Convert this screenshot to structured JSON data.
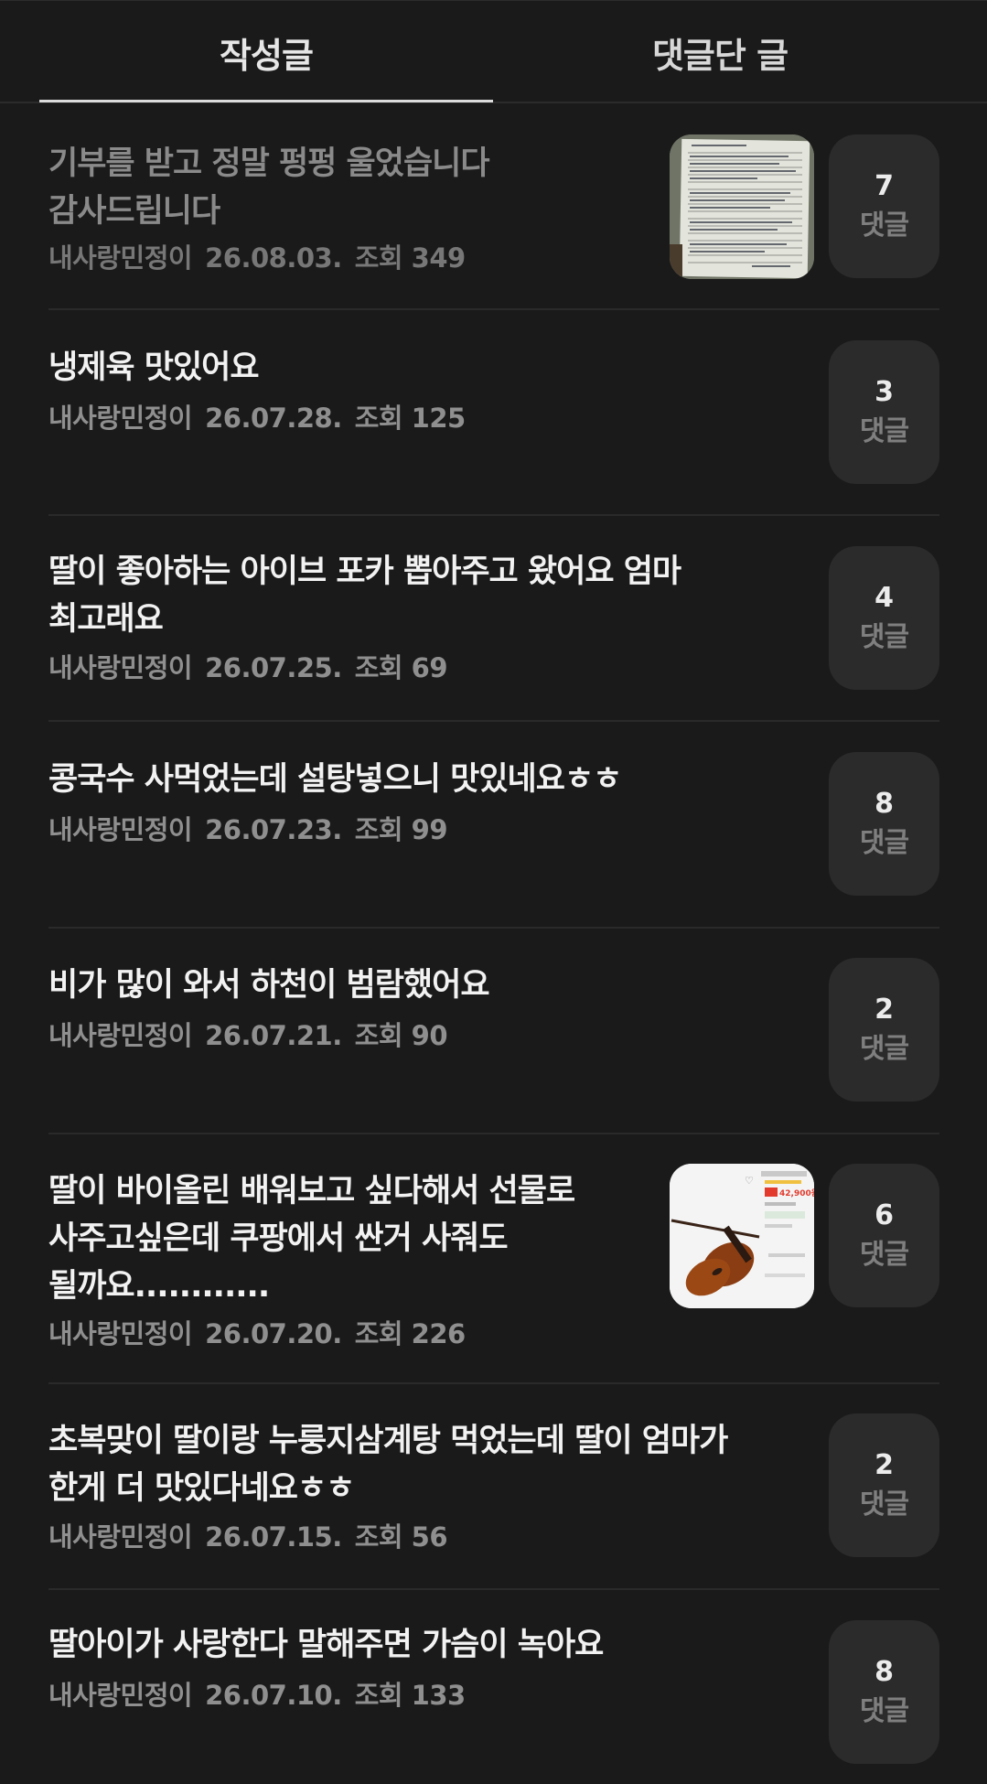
{
  "tabs": [
    {
      "label": "작성글"
    },
    {
      "label": "댓글단 글"
    }
  ],
  "comment_label": "댓글",
  "posts": [
    {
      "title": "기부를 받고 정말 펑펑 울었습니다\n감사드립니다",
      "author": "내사랑민정이",
      "date": "26.08.03.",
      "views": "조회 349",
      "comments": "7",
      "thumbnail": "letter",
      "dimmed": true
    },
    {
      "title": "냉제육 맛있어요",
      "author": "내사랑민정이",
      "date": "26.07.28.",
      "views": "조회 125",
      "comments": "3",
      "thumbnail": null
    },
    {
      "title": "딸이 좋아하는 아이브 포카 뽑아주고 왔어요 엄마\n최고래요",
      "author": "내사랑민정이",
      "date": "26.07.25.",
      "views": "조회 69",
      "comments": "4",
      "thumbnail": null
    },
    {
      "title": "콩국수 사먹었는데 설탕넣으니 맛있네요ㅎㅎ",
      "author": "내사랑민정이",
      "date": "26.07.23.",
      "views": "조회 99",
      "comments": "8",
      "thumbnail": null
    },
    {
      "title": "비가 많이 와서 하천이 범람했어요",
      "author": "내사랑민정이",
      "date": "26.07.21.",
      "views": "조회 90",
      "comments": "2",
      "thumbnail": null
    },
    {
      "title": "딸이 바이올린 배워보고 싶다해서 선물로\n사주고싶은데 쿠팡에서 싼거 사줘도\n될까요............",
      "author": "내사랑민정이",
      "date": "26.07.20.",
      "views": "조회 226",
      "comments": "6",
      "thumbnail": "violin",
      "thumb_price": "42,900원"
    },
    {
      "title": "초복맞이 딸이랑 누룽지삼계탕 먹었는데 딸이 엄마가\n한게 더 맛있다네요ㅎㅎ",
      "author": "내사랑민정이",
      "date": "26.07.15.",
      "views": "조회 56",
      "comments": "2",
      "thumbnail": null
    },
    {
      "title": "딸아이가 사랑한다 말해주면 가슴이 녹아요",
      "author": "내사랑민정이",
      "date": "26.07.10.",
      "views": "조회 133",
      "comments": "8",
      "thumbnail": null
    }
  ]
}
